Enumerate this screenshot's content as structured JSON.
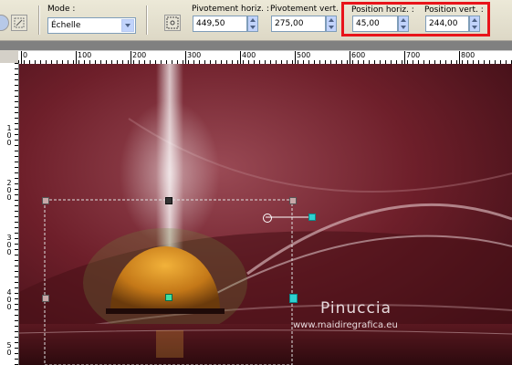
{
  "toolbar": {
    "mode_label": "Mode :",
    "mode_value": "Échelle",
    "pivot_h_label": "Pivotement horiz. :",
    "pivot_h_value": "449,50",
    "pivot_v_label": "Pivotement vert. :",
    "pivot_v_value": "275,00",
    "pos_h_label": "Position horiz. :",
    "pos_h_value": "45,00",
    "pos_v_label": "Position vert. :",
    "pos_v_value": "244,00"
  },
  "ruler": {
    "h_ticks": [
      "0",
      "100",
      "200",
      "300",
      "400",
      "500",
      "600",
      "700",
      "800"
    ],
    "v_ticks": [
      [
        "1",
        "0",
        "0"
      ],
      [
        "2",
        "0",
        "0"
      ],
      [
        "3",
        "0",
        "0"
      ],
      [
        "4",
        "0",
        "0"
      ],
      [
        "5",
        "0"
      ]
    ]
  },
  "watermark": {
    "title": "Pinuccia",
    "url": "www.maidiregrafica.eu"
  },
  "colors": {
    "highlight": "#e8141a",
    "canvas_bg": "#6e1f2a",
    "handle": "#2ed0d0"
  }
}
